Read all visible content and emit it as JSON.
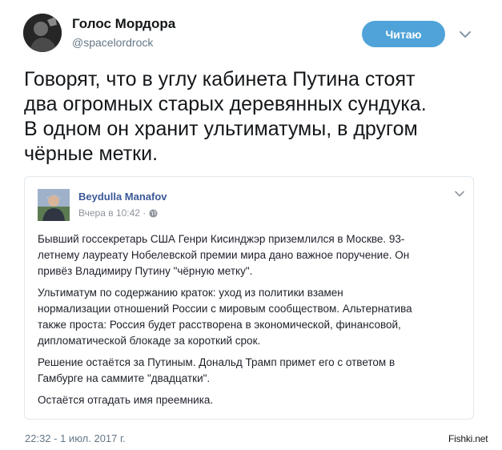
{
  "author": {
    "name": "Голос Мордора",
    "handle": "@spacelordrock"
  },
  "follow_button": {
    "label": "Читаю"
  },
  "tweet": {
    "lines": [
      "Говорят, что в углу кабинета Путина стоят",
      "два огромных старых деревянных сундука.",
      "В одном он хранит ультиматумы, в другом",
      "чёрные метки."
    ],
    "timestamp": "22:32 - 1 июл. 2017 г."
  },
  "embed": {
    "author": "Beydulla Manafov",
    "meta": "Вчера в 10:42 ·",
    "paragraphs": [
      [
        "Бывший госсекретарь США Генри Кисинджэр приземлился в Москве. 93-",
        "летнему лауреату Нобелевской премии мира дано важное поручение. Он",
        "привёз Владимиру Путину \"чёрную метку\"."
      ],
      [
        "Ультиматум по содержанию краток: уход из политики взамен",
        "нормализации отношений России с мировым сообществом. Альтернатива",
        "также проста: Россия будет расстворена в экономической, финансовой,",
        "дипломатической блокаде за короткий срок."
      ],
      [
        "Решение остаётся за Путиным. Дональд Трамп примет его с ответом в",
        "Гамбурге на саммите \"двадцатки\"."
      ],
      [
        "Остаётся отгадать имя преемника."
      ]
    ]
  },
  "watermark": "Fishki.net",
  "icons": {
    "menu": "chevron-down-icon",
    "embed_menu": "chevron-down-icon",
    "privacy": "globe-icon"
  },
  "colors": {
    "follow_button": "#4fa3d9",
    "embed_author": "#3b5998",
    "secondary_text": "#657786"
  }
}
